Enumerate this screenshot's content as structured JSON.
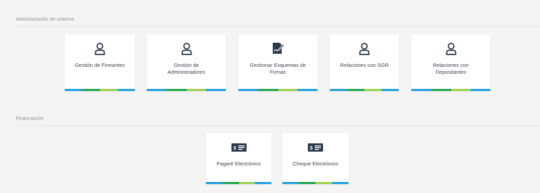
{
  "colors": {
    "accent_blue": "#1ea0e0",
    "accent_green": "#1fa34a",
    "accent_lime": "#9fd04c",
    "icon_dark": "#2c3a4b"
  },
  "sections": [
    {
      "title": "Administración de sistema",
      "cards": [
        {
          "label": "Gestión de Firmantes",
          "icon": "user-icon"
        },
        {
          "label": "Gestión de Administradores",
          "icon": "user-icon"
        },
        {
          "label": "Gestionar Esquemas de Firmas",
          "icon": "document-sign-icon"
        },
        {
          "label": "Relaciones con SGR",
          "icon": "user-icon"
        },
        {
          "label": "Relaciones con Depositantes",
          "icon": "user-icon"
        }
      ]
    },
    {
      "title": "Financiación",
      "cards": [
        {
          "label": "Pagaré Electrónico",
          "icon": "check-icon"
        },
        {
          "label": "Cheque Electrónico",
          "icon": "check-icon"
        }
      ]
    }
  ]
}
